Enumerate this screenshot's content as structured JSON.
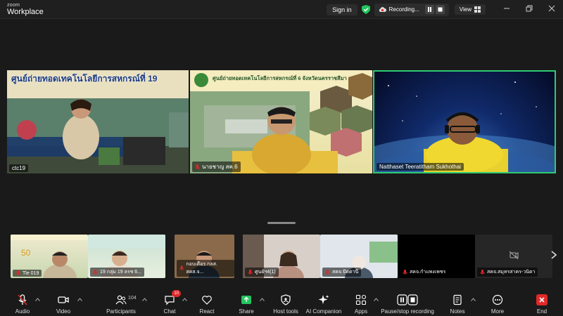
{
  "app": {
    "brand_line1": "zoom",
    "brand_line2": "Workplace"
  },
  "titlebar": {
    "sign_in": "Sign in",
    "recording_label": "Recording...",
    "view_label": "View"
  },
  "colors": {
    "active_speaker": "#2ecc71",
    "muted": "#e02828",
    "share": "#22c55e",
    "end": "#e02828"
  },
  "videos": [
    {
      "name": "ctc19",
      "overlay_text": "ศูนย์ถ่ายทอดเทคโนโลยีการสหกรณ์ที่ 19"
    },
    {
      "name": "นายชาญ สค.6",
      "overlay_text": "ศูนย์ถ่ายทอดเทคโนโลยีการสหกรณ์ที่ 6 จังหวัดนครราชสีมา"
    },
    {
      "name": "Natthaset Teeratitham Sukhothai"
    }
  ],
  "thumbnails": [
    {
      "name": "Tle 019"
    },
    {
      "name": "19 กลุ่ม 19 ลรช 6..."
    },
    {
      "name": "กอบเดือร กลส. สคส.จ..."
    },
    {
      "name": "ศูนย์ฯ4(1)"
    },
    {
      "name": "สคจ.ปัตตานี"
    },
    {
      "name": "สคจ.กำแพงเพชร"
    },
    {
      "name": "สคจ.สมุทรสาคร-วนิดา"
    }
  ],
  "toolbar": {
    "audio": "Audio",
    "video": "Video",
    "participants": "Participants",
    "participants_count": "104",
    "chat": "Chat",
    "chat_badge": "10",
    "react": "React",
    "share": "Share",
    "host_tools": "Host tools",
    "ai_companion": "AI Companion",
    "apps": "Apps",
    "pause_stop_recording": "Pause/stop recording",
    "notes": "Notes",
    "more": "More",
    "end": "End"
  }
}
